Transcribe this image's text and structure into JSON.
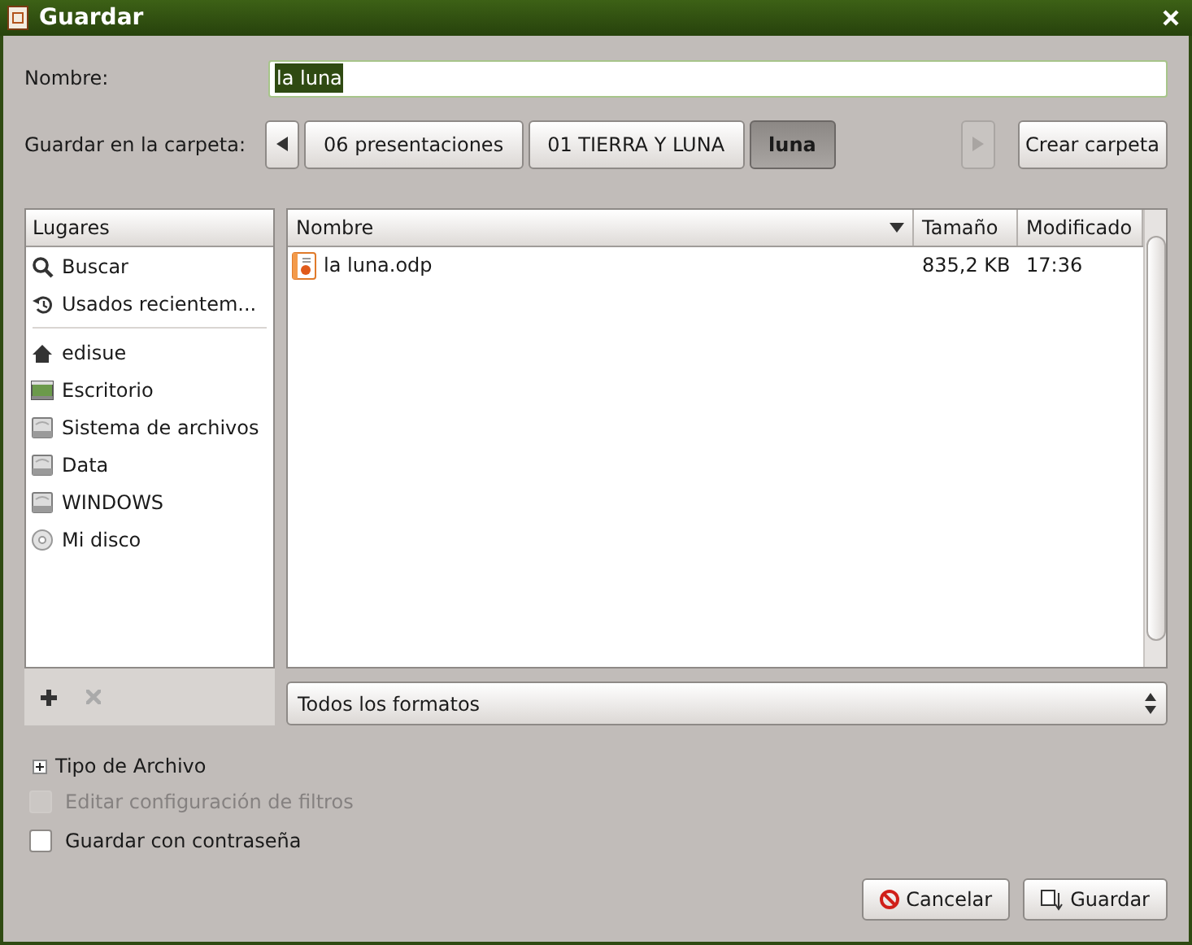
{
  "window": {
    "title": "Guardar"
  },
  "name_field": {
    "label": "Nombre:",
    "value": "la luna",
    "text_selected": true
  },
  "folder_bar": {
    "label": "Guardar en la carpeta:",
    "crumbs": [
      {
        "label": "06 presentaciones",
        "selected": false
      },
      {
        "label": "01 TIERRA Y LUNA",
        "selected": false
      },
      {
        "label": "luna",
        "selected": true
      }
    ],
    "back_disabled": false,
    "forward_disabled": true,
    "create_button": "Crear carpeta"
  },
  "places": {
    "header": "Lugares",
    "groups": [
      [
        {
          "label": "Buscar",
          "kind": "search"
        },
        {
          "label": "Usados recientem...",
          "kind": "recent"
        }
      ],
      [
        {
          "label": "edisue",
          "kind": "home"
        },
        {
          "label": "Escritorio",
          "kind": "desktop"
        },
        {
          "label": "Sistema de archivos",
          "kind": "drive"
        },
        {
          "label": "Data",
          "kind": "drive"
        },
        {
          "label": "WINDOWS",
          "kind": "drive"
        },
        {
          "label": "Mi disco",
          "kind": "disc"
        }
      ]
    ],
    "add_disabled": false,
    "remove_disabled": true
  },
  "files": {
    "columns": [
      {
        "label": "Nombre",
        "sorted": true
      },
      {
        "label": "Tamaño",
        "sorted": false
      },
      {
        "label": "Modificado",
        "sorted": false
      }
    ],
    "rows": [
      {
        "name": "la luna.odp",
        "size": "835,2 KB",
        "modified": "17:36"
      }
    ]
  },
  "filter": {
    "value": "Todos los formatos"
  },
  "file_type": {
    "label": "Tipo de Archivo",
    "expanded": false
  },
  "options": [
    {
      "label": "Editar configuración de filtros",
      "checked": false,
      "disabled": true
    },
    {
      "label": "Guardar con contraseña",
      "checked": false,
      "disabled": false
    }
  ],
  "buttons": [
    {
      "label": "Cancelar",
      "kind": "cancel"
    },
    {
      "label": "Guardar",
      "kind": "save"
    }
  ]
}
